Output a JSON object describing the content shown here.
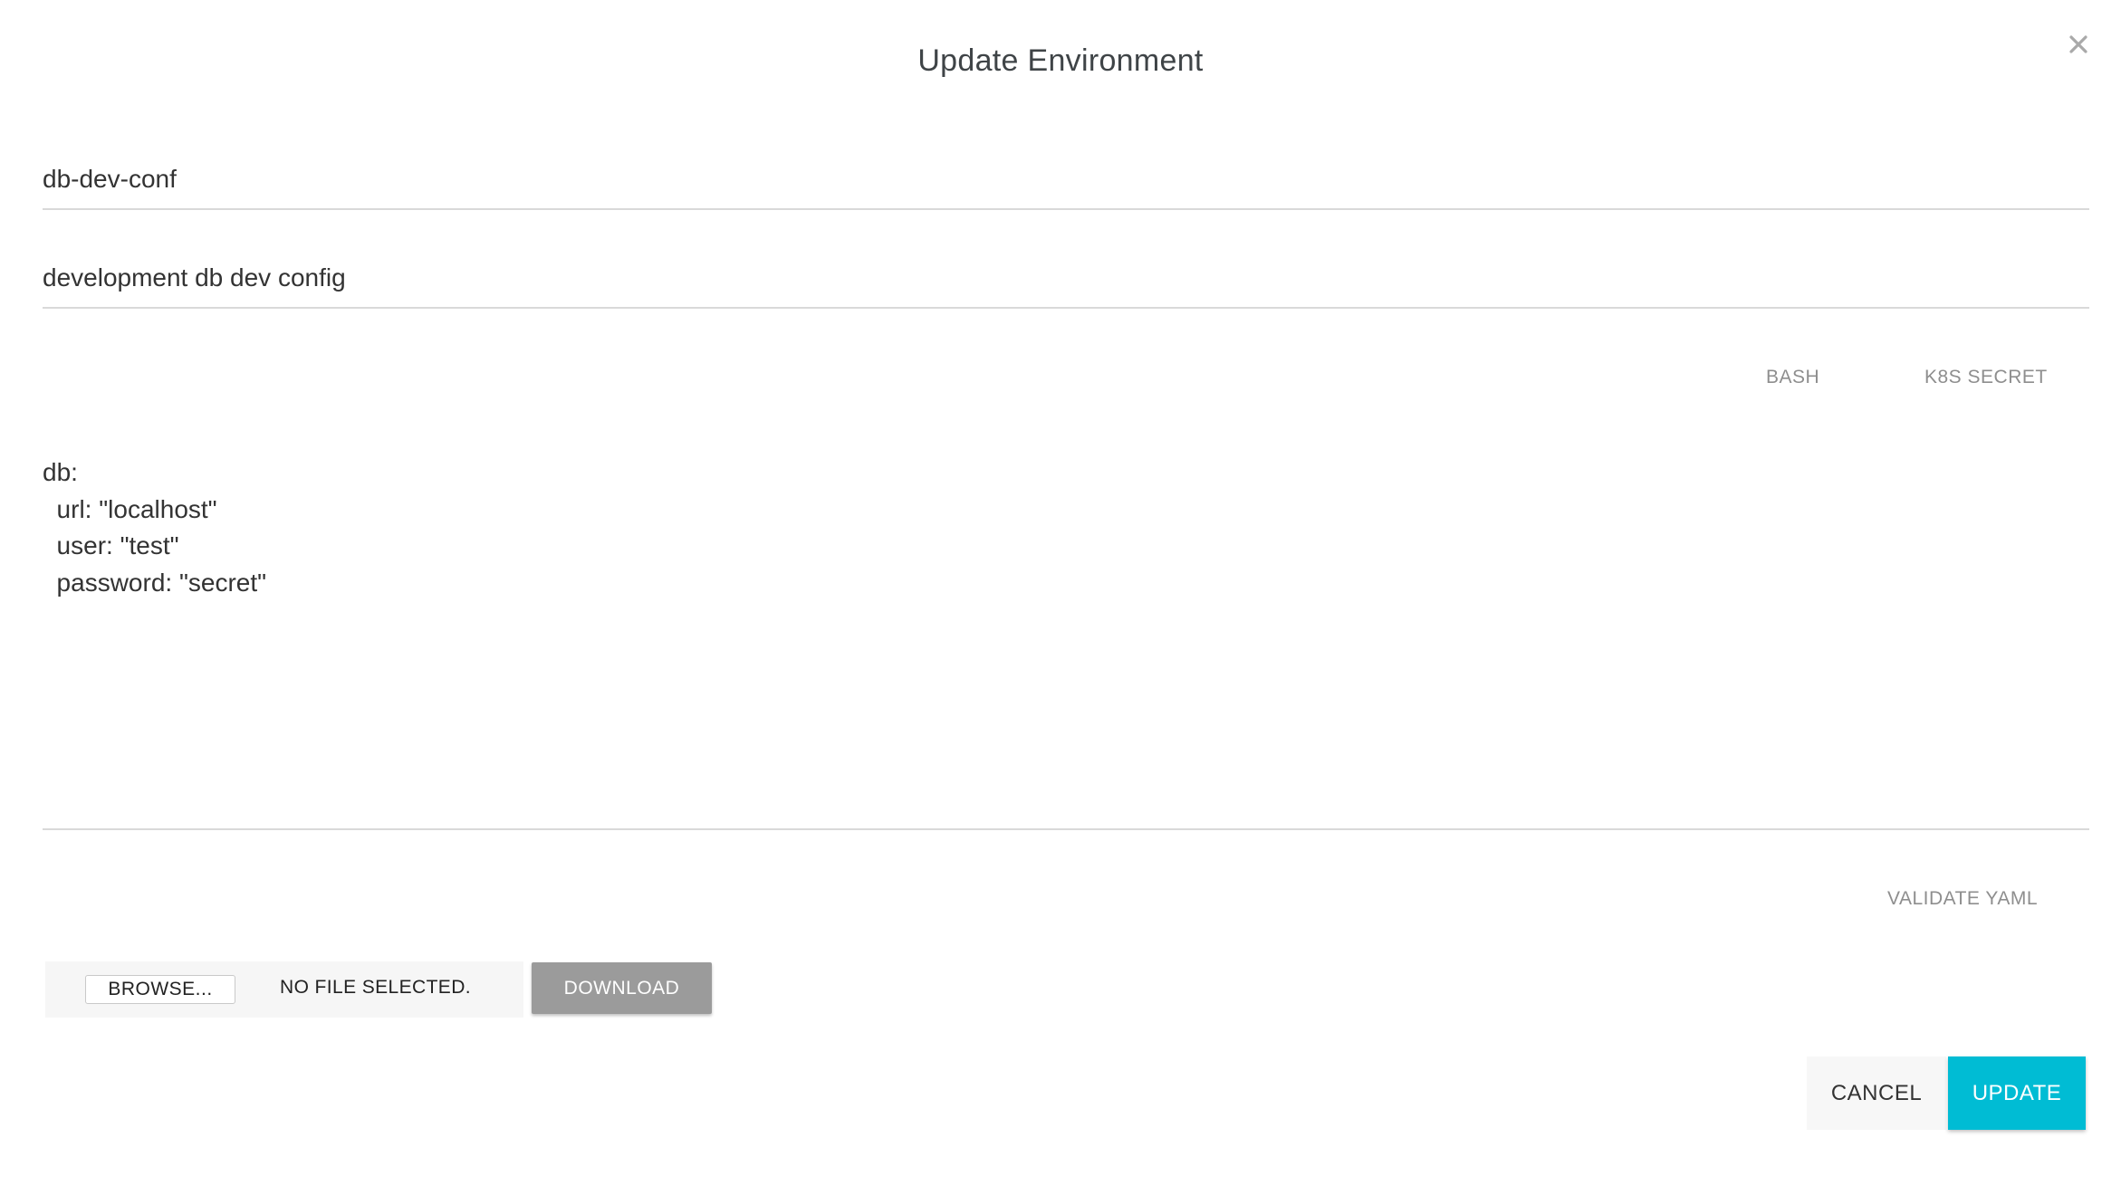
{
  "dialog": {
    "title": "Update Environment",
    "close_icon": "close-icon"
  },
  "form": {
    "name_value": "db-dev-conf",
    "description_value": "development db dev config"
  },
  "format_tabs": {
    "bash_label": "BASH",
    "k8s_secret_label": "K8S SECRET"
  },
  "yaml": {
    "lines": [
      "db:",
      "  url: \"localhost\"",
      "  user: \"test\"",
      "  password: \"secret\""
    ]
  },
  "actions": {
    "validate_label": "VALIDATE YAML",
    "browse_label": "BROWSE...",
    "file_status": "NO FILE SELECTED.",
    "download_label": "DOWNLOAD",
    "cancel_label": "CANCEL",
    "update_label": "UPDATE"
  },
  "colors": {
    "accent": "#00bcd4",
    "download_bg": "#9b9b9b",
    "link_text": "#8e8e8e"
  }
}
